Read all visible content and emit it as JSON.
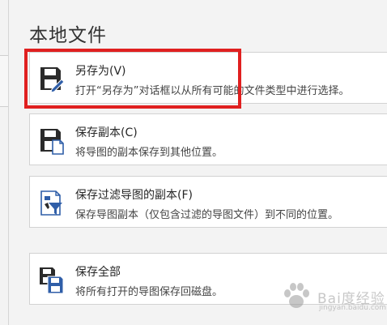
{
  "section": {
    "title": "本地文件"
  },
  "options": [
    {
      "title": "另存为(V)",
      "description": "打开“另存为”对话框以从所有可能的文件类型中进行选择。",
      "icon": "save-as-icon"
    },
    {
      "title": "保存副本(C)",
      "description": "将导图的副本保存到其他位置。",
      "icon": "save-copy-icon"
    },
    {
      "title": "保存过滤导图的副本(F)",
      "description": "保存导图副本（仅包含过滤的导图文件）到不同的位置。",
      "icon": "save-filtered-copy-icon"
    },
    {
      "title": "保存全部",
      "description": "将所有打开的导图保存回磁盘。",
      "icon": "save-all-icon"
    }
  ],
  "watermark": {
    "text": "Bai度经验",
    "sub": "jingyan.baidu.com"
  },
  "colors": {
    "highlight": "#e02020",
    "icon_dark": "#2b2b2b",
    "icon_blue": "#2f5ea8"
  }
}
